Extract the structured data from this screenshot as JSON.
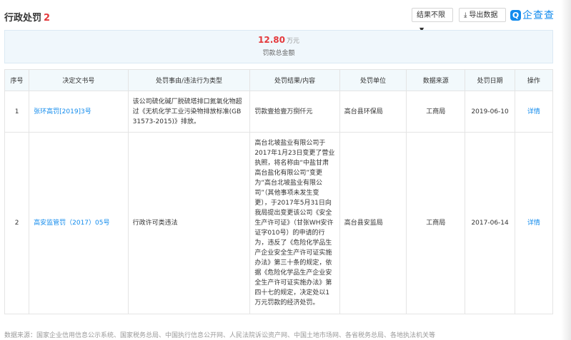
{
  "header": {
    "title": "行政处罚",
    "count": "2",
    "filter_label": "结果不限",
    "export_label": "导出数据",
    "logo_text": "企查查",
    "logo_mark": "Q"
  },
  "summary": {
    "amount": "12.80",
    "unit": "万元",
    "label": "罚款总金额"
  },
  "table": {
    "columns": [
      "序号",
      "决定文书号",
      "处罚事由/违法行为类型",
      "处罚结果/内容",
      "处罚单位",
      "数据来源",
      "处罚日期",
      "操作"
    ],
    "rows": [
      {
        "index": "1",
        "doc_no": "张环高罚[2019]3号",
        "reason": "该公司硫化碱厂脱硫塔排口氮氧化物超过《无机化学工业污染物排放标准(GB 31573-2015)》排放。",
        "result": "罚款壹拾壹万捌仟元",
        "authority": "高台县环保局",
        "source": "工商局",
        "date": "2019-06-10",
        "action": "详情"
      },
      {
        "index": "2",
        "doc_no": "高安监管罚（2017）05号",
        "reason": "行政许可类违法",
        "result": "高台北坡盐业有限公司于2017年1月23日变更了营业执照，将名称由“中盐甘肃高台盐化有限公司”变更为“高台北坡盐业有限公司”（其他事项未发生变更），于2017年5月31日向我局提出变更该公司《安全生产许可证》（甘张WH安许证字010号）的申请的行为，违反了《危险化学品生产企业安全生产许可证实施办法》第三十条的规定，依据《危险化学品生产企业安全生产许可证实施办法》第四十七的规定，决定处以1万元罚款的经济处罚。",
        "authority": "高台县安监局",
        "source": "工商局",
        "date": "2017-06-14",
        "action": "详情"
      }
    ]
  },
  "footer": {
    "text": "数据来源：国家企业信用信息公示系统、国家税务总局、中国执行信息公开网、人民法院诉讼资产网、中国土地市场网、各省税务总局、各地执法机关等"
  },
  "colors": {
    "accent": "#128bed",
    "red": "#e4393c",
    "header_bg": "#f2f9fc"
  }
}
